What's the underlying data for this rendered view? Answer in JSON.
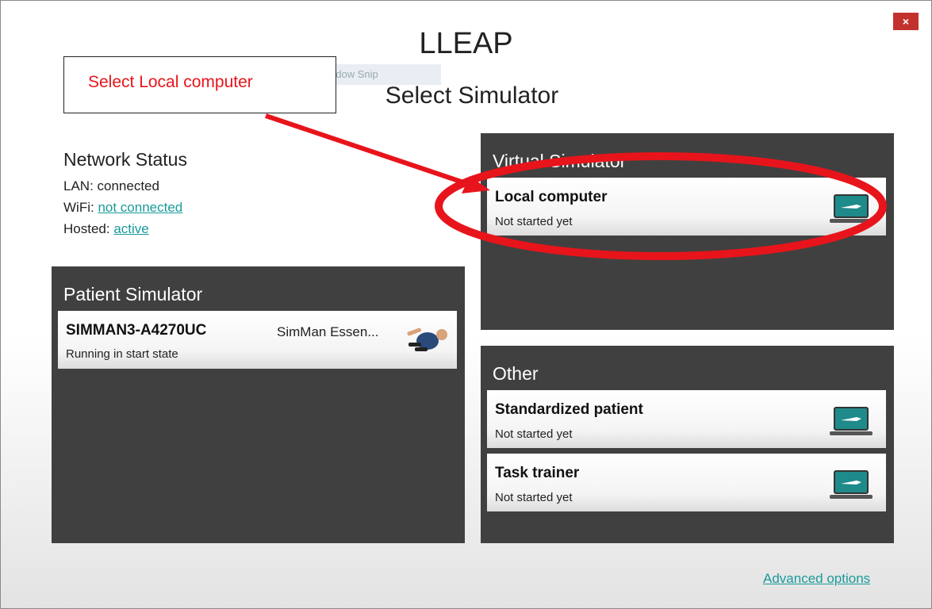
{
  "window": {
    "app_title": "LLEAP",
    "subtitle": "Select Simulator",
    "close_label": "×",
    "ghost_text": "ndow Snip"
  },
  "annotation": {
    "callout_text": "Select Local computer",
    "color": "#e8141b"
  },
  "network": {
    "title": "Network Status",
    "lan_label": "LAN: connected",
    "wifi_label": "WiFi: ",
    "wifi_value": "not connected",
    "hosted_label": "Hosted: ",
    "hosted_value": "active"
  },
  "patient_simulator": {
    "title": "Patient Simulator",
    "device": {
      "name": "SIMMAN3-A4270UC",
      "model": "SimMan Essen...",
      "status": "Running in start state",
      "icon": "manikin-icon"
    }
  },
  "virtual_simulator": {
    "title": "Virtual Simulator",
    "items": [
      {
        "name": "Local computer",
        "status": "Not started yet",
        "icon": "laptop-icon"
      }
    ]
  },
  "other": {
    "title": "Other",
    "items": [
      {
        "name": "Standardized patient",
        "status": "Not started yet",
        "icon": "laptop-icon"
      },
      {
        "name": "Task trainer",
        "status": "Not started yet",
        "icon": "laptop-icon"
      }
    ]
  },
  "footer": {
    "advanced_options": "Advanced options"
  },
  "colors": {
    "panel": "#404040",
    "link": "#1a9a9a",
    "close": "#c2312d",
    "laptop_screen": "#1f8a8a"
  }
}
